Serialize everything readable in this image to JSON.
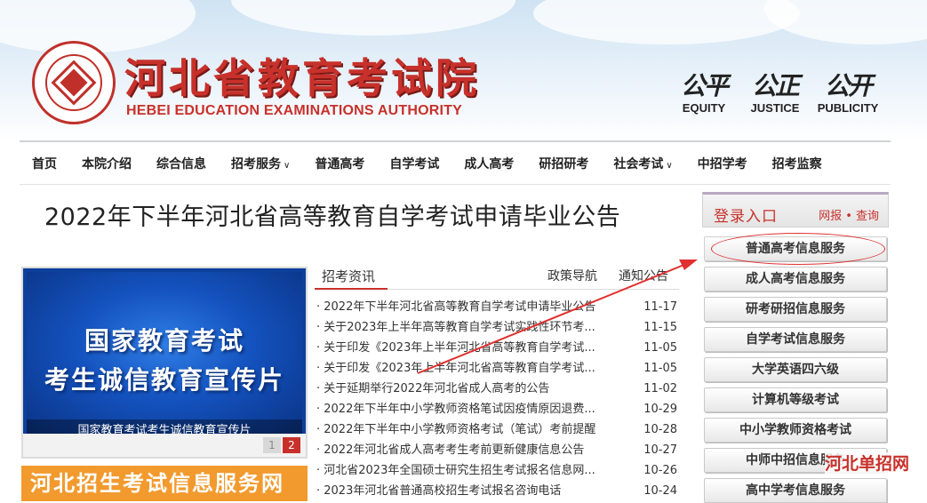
{
  "header": {
    "title": "河北省教育考试院",
    "subtitle": "HEBEI EDUCATION EXAMINATIONS AUTHORITY",
    "mottos": [
      {
        "cn": "公平",
        "en": "EQUITY"
      },
      {
        "cn": "公正",
        "en": "JUSTICE"
      },
      {
        "cn": "公开",
        "en": "PUBLICITY"
      }
    ]
  },
  "nav": {
    "items": [
      {
        "label": "首页",
        "dropdown": false
      },
      {
        "label": "本院介绍",
        "dropdown": false
      },
      {
        "label": "综合信息",
        "dropdown": false
      },
      {
        "label": "招考服务",
        "dropdown": true
      },
      {
        "label": "普通高考",
        "dropdown": false
      },
      {
        "label": "自学考试",
        "dropdown": false
      },
      {
        "label": "成人高考",
        "dropdown": false
      },
      {
        "label": "研招研考",
        "dropdown": false
      },
      {
        "label": "社会考试",
        "dropdown": true
      },
      {
        "label": "中招学考",
        "dropdown": false
      },
      {
        "label": "招考监察",
        "dropdown": false
      }
    ]
  },
  "article": {
    "title": "2022年下半年河北省高等教育自学考试申请毕业公告"
  },
  "banner": {
    "line1": "国家教育考试",
    "line2": "考生诚信教育宣传片",
    "caption": "国家教育考试考生诚信教育宣传片",
    "pages": [
      "1",
      "2"
    ],
    "active_page": "2"
  },
  "promo": {
    "text": "河北招生考试信息服务网"
  },
  "news": {
    "tabs": [
      "招考资讯",
      "政策导航",
      "通知公告"
    ],
    "items": [
      {
        "title": "· 2022年下半年河北省高等教育自学考试申请毕业公告",
        "date": "11-17"
      },
      {
        "title": "· 关于2023年上半年高等教育自学考试实践性环节考...",
        "date": "11-15"
      },
      {
        "title": "· 关于印发《2023年上半年河北省高等教育自学考试...",
        "date": "11-05"
      },
      {
        "title": "· 关于印发《2023年上半年河北省高等教育自学考试...",
        "date": "11-05"
      },
      {
        "title": "· 关于延期举行2022年河北省成人高考的公告",
        "date": "11-02"
      },
      {
        "title": "· 2022年下半年中小学教师资格笔试因疫情原因退费...",
        "date": "10-29"
      },
      {
        "title": "· 2022年下半年中小学教师资格考试（笔试）考前提醒",
        "date": "10-28"
      },
      {
        "title": "· 2022年河北省成人高考考生考前更新健康信息公告",
        "date": "10-27"
      },
      {
        "title": "· 河北省2023年全国硕士研究生招生考试报名信息网...",
        "date": "10-26"
      },
      {
        "title": "· 2023年河北省普通高校招生考试报名咨询电话",
        "date": "10-24"
      }
    ]
  },
  "login": {
    "title": "登录入口",
    "links": "网报 • 查询"
  },
  "services": [
    "普通高考信息服务",
    "成人高考信息服务",
    "研考研招信息服务",
    "自学考试信息服务",
    "大学英语四六级",
    "计算机等级考试",
    "中小学教师资格考试",
    "中师中招信息服务",
    "高中学考信息服务"
  ],
  "watermark": "河北单招网",
  "colors": {
    "brand_red": "#c8312b",
    "annotation_red": "#e03030",
    "promo_orange": "#f29a2e"
  }
}
